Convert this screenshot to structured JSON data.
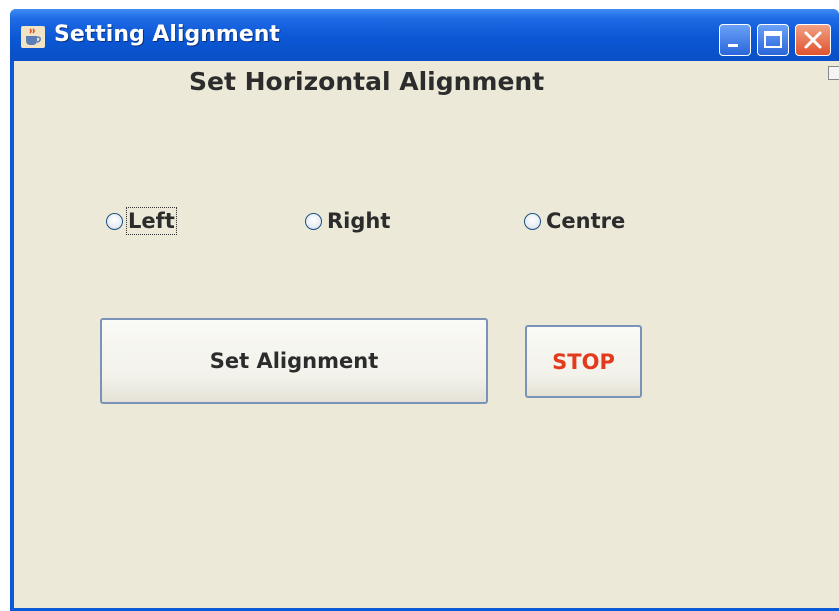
{
  "window": {
    "title": "Setting Alignment",
    "icon": "java-cup-icon",
    "controls": [
      "minimize-icon",
      "maximize-icon",
      "close-icon"
    ]
  },
  "heading": "Set Horizontal Alignment",
  "radios": [
    {
      "label": "Left",
      "selected": false,
      "focused": true
    },
    {
      "label": "Right",
      "selected": false,
      "focused": false
    },
    {
      "label": "Centre",
      "selected": false,
      "focused": false
    }
  ],
  "buttons": {
    "set_alignment": "Set Alignment",
    "stop": "STOP"
  },
  "colors": {
    "titlebar": "#0b57d4",
    "client_background": "#ece9d8",
    "stop_text": "#e23a1c",
    "close_button": "#e0532f"
  }
}
